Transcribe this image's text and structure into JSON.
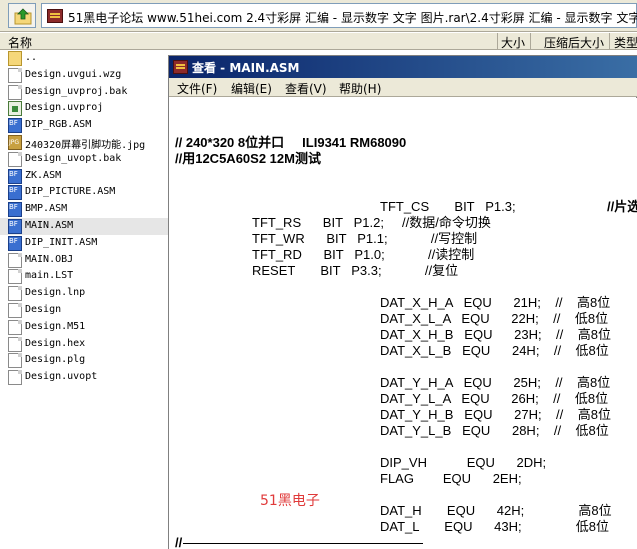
{
  "topbar": {
    "path": "51黑电子论坛 www.51hei.com 2.4寸彩屏 汇编 - 显示数字 文字 图片.rar\\2.4寸彩屏 汇编 - 显示数字 文字"
  },
  "columns": {
    "name": "名称",
    "size": "大小",
    "packed": "压缩后大小",
    "type": "类型"
  },
  "files": [
    {
      "name": "..",
      "icon": "folder-icon"
    },
    {
      "name": "Design.uvgui.wzg",
      "icon": "document-icon"
    },
    {
      "name": "Design_uvproj.bak",
      "icon": "document-icon"
    },
    {
      "name": "Design.uvproj",
      "icon": "uvision-project-icon"
    },
    {
      "name": "DIP_RGB.ASM",
      "icon": "asm-file-icon"
    },
    {
      "name": "240320屏幕引脚功能.jpg",
      "icon": "jpg-file-icon"
    },
    {
      "name": "Design_uvopt.bak",
      "icon": "document-icon"
    },
    {
      "name": "ZK.ASM",
      "icon": "asm-file-icon"
    },
    {
      "name": "DIP_PICTURE.ASM",
      "icon": "asm-file-icon"
    },
    {
      "name": "BMP.ASM",
      "icon": "asm-file-icon"
    },
    {
      "name": "MAIN.ASM",
      "icon": "asm-file-icon",
      "selected": true
    },
    {
      "name": "DIP_INIT.ASM",
      "icon": "asm-file-icon"
    },
    {
      "name": "MAIN.OBJ",
      "icon": "document-icon"
    },
    {
      "name": "main.LST",
      "icon": "document-icon"
    },
    {
      "name": "Design.lnp",
      "icon": "document-icon"
    },
    {
      "name": "Design",
      "icon": "document-icon"
    },
    {
      "name": "Design.M51",
      "icon": "document-icon"
    },
    {
      "name": "Design.hex",
      "icon": "document-icon"
    },
    {
      "name": "Design.plg",
      "icon": "document-icon"
    },
    {
      "name": "Design.uvopt",
      "icon": "document-icon"
    }
  ],
  "editor": {
    "title": "查看 - MAIN.ASM",
    "menu": [
      "文件(F)",
      "编辑(E)",
      "查看(V)",
      "帮助(H)"
    ],
    "lines": [
      {
        "text": "// 240*320 8位并口     ILI9341 RM68090",
        "bold": true
      },
      {
        "text": "//用12C5A60S2 12M测试",
        "bold": true
      },
      {
        "text": "TFT_CS       BIT   P1.3;"
      },
      {
        "text": "//片选"
      },
      {
        "text": "TFT_RS      BIT   P1.2;     //数据/命令切换"
      },
      {
        "text": "TFT_WR      BIT   P1.1;            //写控制"
      },
      {
        "text": "TFT_RD      BIT   P1.0;            //读控制"
      },
      {
        "text": "RESET       BIT   P3.3;            //复位"
      },
      {
        "text": "DAT_X_H_A   EQU      21H;    //    高8位"
      },
      {
        "text": "DAT_X_L_A   EQU      22H;    //    低8位"
      },
      {
        "text": "DAT_X_H_B   EQU      23H;    //    高8位"
      },
      {
        "text": "DAT_X_L_B   EQU      24H;    //    低8位"
      },
      {
        "text": "DAT_Y_H_A   EQU      25H;    //    高8位"
      },
      {
        "text": "DAT_Y_L_A   EQU      26H;    //    低8位"
      },
      {
        "text": "DAT_Y_H_B   EQU      27H;    //    高8位"
      },
      {
        "text": "DAT_Y_L_B   EQU      28H;    //    低8位"
      },
      {
        "text": "DIP_VH           EQU      2DH;"
      },
      {
        "text": "FLAG        EQU      2EH;"
      },
      {
        "text": "DAT_H       EQU      42H;               高8位"
      },
      {
        "text": "DAT_L       EQU      43H;               低8位"
      }
    ],
    "watermark": "51黑电子",
    "last_line": "//"
  },
  "colors": {
    "title_start": "#0a246a",
    "title_end": "#3a6ea5",
    "watermark": "#e03a3a",
    "selection": "#e6e6e6"
  }
}
